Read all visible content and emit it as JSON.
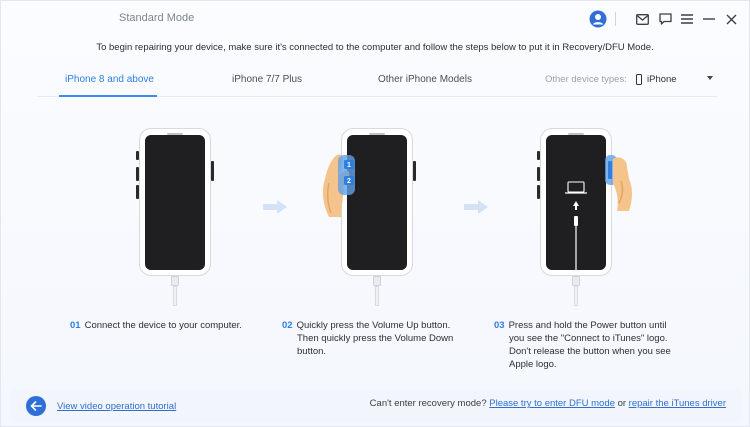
{
  "app": {
    "title": "Standard Mode"
  },
  "header": {
    "instruction": "To begin repairing your device, make sure it's connected to the computer and follow the steps below to put it in Recovery/DFU Mode."
  },
  "tabs": [
    {
      "label": "iPhone 8 and above",
      "active": true
    },
    {
      "label": "iPhone 7/7 Plus",
      "active": false
    },
    {
      "label": "Other iPhone Models",
      "active": false
    }
  ],
  "device_types": {
    "label": "Other device types:",
    "selected": "iPhone"
  },
  "steps": [
    {
      "num": "01",
      "lines": [
        "Connect the device to your computer."
      ]
    },
    {
      "num": "02",
      "lines": [
        "Quickly press the Volume Up button.",
        "Then quickly press the Volume Down",
        "button."
      ]
    },
    {
      "num": "03",
      "lines": [
        "Press and hold the Power button until",
        "you see the \"Connect to iTunes\" logo.",
        "Don't release the button when you see",
        "Apple logo."
      ]
    }
  ],
  "footer": {
    "tutorial_link": "View video operation tutorial",
    "prompt": "Can't enter recovery mode?",
    "dfu_link": "Please try to enter DFU mode",
    "or": "or",
    "itunes_link": "repair the iTunes driver"
  },
  "colors": {
    "accent": "#2f7fe0",
    "phone_screen": "#1f1f22"
  },
  "icons": [
    "user-avatar-icon",
    "mail-icon",
    "chat-icon",
    "menu-icon",
    "minimize-icon",
    "close-icon",
    "back-arrow-icon",
    "phone-icon",
    "caret-down-icon",
    "step-arrow-icon",
    "hand-icon",
    "laptop-icon",
    "up-arrow-icon"
  ]
}
